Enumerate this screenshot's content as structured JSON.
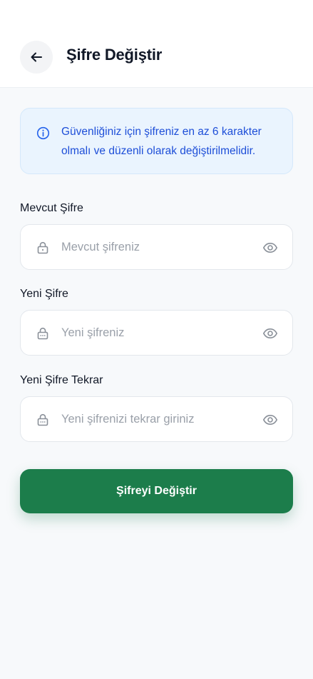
{
  "header": {
    "title": "Şifre Değiştir",
    "back_icon": "arrow-left-icon"
  },
  "info": {
    "icon": "info-circle-icon",
    "text": "Güvenliğiniz için şifreniz en az 6 karakter olmalı ve düzenli olarak değiştirilmelidir."
  },
  "form": {
    "current": {
      "label": "Mevcut Şifre",
      "placeholder": "Mevcut şifreniz",
      "value": ""
    },
    "new": {
      "label": "Yeni Şifre",
      "placeholder": "Yeni şifreniz",
      "value": ""
    },
    "confirm": {
      "label": "Yeni Şifre Tekrar",
      "placeholder": "Yeni şifrenizi tekrar giriniz",
      "value": ""
    }
  },
  "submit_label": "Şifreyi Değiştir",
  "colors": {
    "primary": "#1c7d4b",
    "info_bg": "#eaf4fe",
    "info_text": "#1d4ed8"
  }
}
